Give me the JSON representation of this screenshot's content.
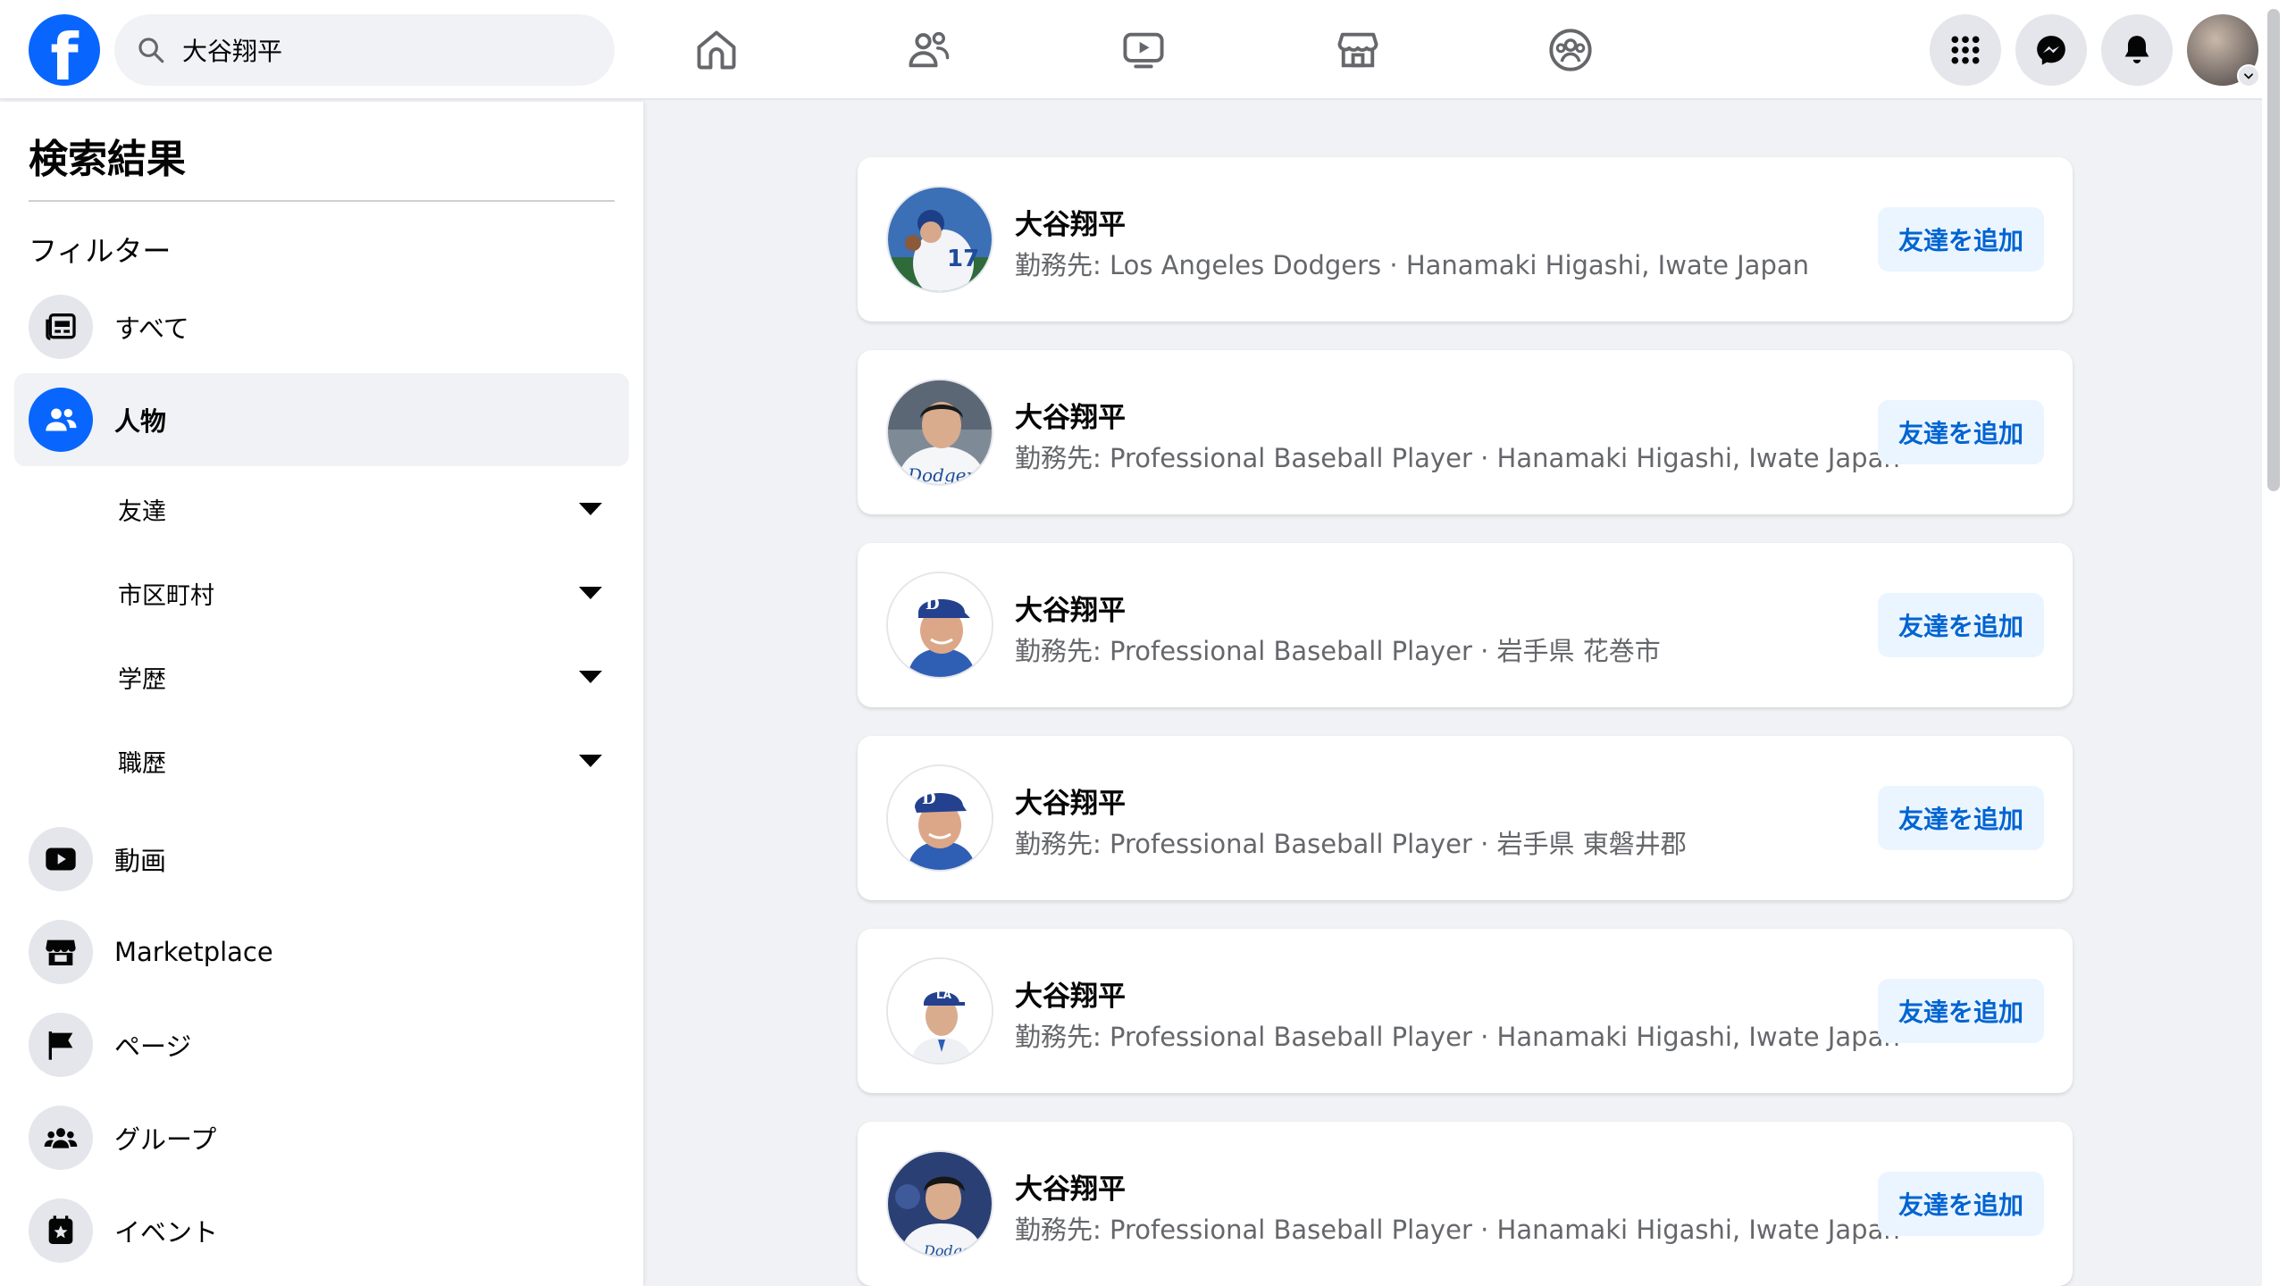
{
  "search": {
    "value": "大谷翔平"
  },
  "sidebar": {
    "title": "検索結果",
    "filter_heading": "フィルター",
    "items": [
      {
        "label": "すべて",
        "icon": "feed-icon"
      },
      {
        "label": "人物",
        "icon": "people-icon",
        "active": true
      },
      {
        "label": "動画",
        "icon": "video-icon"
      },
      {
        "label": "Marketplace",
        "icon": "marketplace-icon"
      },
      {
        "label": "ページ",
        "icon": "flag-icon"
      },
      {
        "label": "グループ",
        "icon": "groups-icon"
      },
      {
        "label": "イベント",
        "icon": "event-icon"
      }
    ],
    "people_filters": [
      {
        "label": "友達"
      },
      {
        "label": "市区町村"
      },
      {
        "label": "学歴"
      },
      {
        "label": "職歴"
      }
    ]
  },
  "results": [
    {
      "name": "大谷翔平",
      "subtitle": "勤務先: Los Angeles Dodgers · Hanamaki Higashi, Iwate Japan",
      "button": "友達を追加"
    },
    {
      "name": "大谷翔平",
      "subtitle": "勤務先: Professional Baseball Player · Hanamaki Higashi, Iwate Japan",
      "button": "友達を追加"
    },
    {
      "name": "大谷翔平",
      "subtitle": "勤務先: Professional Baseball Player · 岩手県 花巻市",
      "button": "友達を追加"
    },
    {
      "name": "大谷翔平",
      "subtitle": "勤務先: Professional Baseball Player · 岩手県 東磐井郡",
      "button": "友達を追加"
    },
    {
      "name": "大谷翔平",
      "subtitle": "勤務先: Professional Baseball Player · Hanamaki Higashi, Iwate Japan",
      "button": "友達を追加"
    },
    {
      "name": "大谷翔平",
      "subtitle": "勤務先: Professional Baseball Player · Hanamaki Higashi, Iwate Japan",
      "button": "友達を追加"
    }
  ],
  "colors": {
    "brand": "#0866ff",
    "button_bg": "#ebf5ff",
    "button_text": "#0064d1"
  }
}
